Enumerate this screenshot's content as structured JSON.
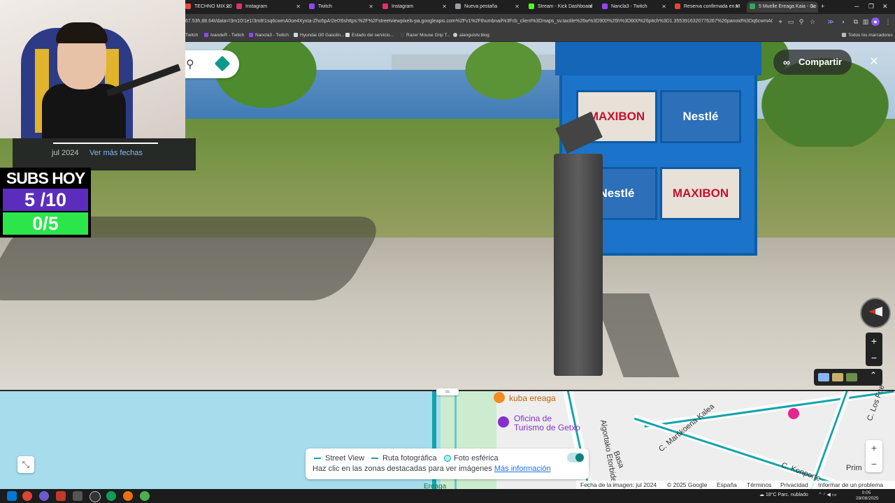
{
  "browser": {
    "tabs": [
      {
        "label": "TECHNO MIX 20",
        "color": "#e74c3c"
      },
      {
        "label": "Instagram",
        "color": "#e1306c"
      },
      {
        "label": "Twitch",
        "color": "#9146ff"
      },
      {
        "label": "Instagram",
        "color": "#e1306c"
      },
      {
        "label": "Nueva pestaña",
        "color": "#9aa0a6"
      },
      {
        "label": "Stream - Kick Dashboard",
        "color": "#53fc18"
      },
      {
        "label": "Nancla3 - Twitch",
        "color": "#9146ff"
      },
      {
        "label": "Reserva confirmada en M",
        "color": "#ea4335"
      },
      {
        "label": "5 Muelle Ereaga Kaia - Go",
        "color": "#34a853"
      }
    ],
    "new_tab": "+",
    "url": "67.53h,88.64t/data=!3m10!1e1!3m8!1sq6cwmA0oe4XyxIa-Zho5pA!2e0!6shttps:%2F%2Fstreetviewpixels-pa.googleapis.com%2Fv1%2Fthumbnail%3Fcb_client%3Dmaps_sv.tactile%26w%3D900%26h%3D600%26pitch%3D1.3553916320776267%26panoid%3Dq6cwmA0oe4...",
    "bookmarks": [
      "Twitch",
      "IvandeR - Twitch",
      "Nancla3 - Twitch",
      "Hyundai i30 Gasolin...",
      "Estado del servicio...",
      "Razer Mouse Grip T...",
      "alanguistv.blog"
    ],
    "all_bookmarks": "Todos los marcadores"
  },
  "streetview": {
    "share_label": "Compartir",
    "close_glyph": "✕",
    "kiosk_brands": [
      "MAXIBON",
      "Nestlé",
      "Nestlé",
      "MAXIBON"
    ]
  },
  "overlay": {
    "date": "jul 2024",
    "more_dates": "Ver más fechas",
    "subs_title": "SUBS HOY",
    "subs_count": "5 /10",
    "subs_goal": "0/5"
  },
  "map": {
    "place_1": "kuba ereaga",
    "place_2": "Oficina de\nTurismo de Getxo",
    "place_3": "Ereaga",
    "streets": [
      "Algortako Etorbidea",
      "C. Martikoena Kalea",
      "C. Konporte",
      "C. Los Fue",
      "Basa",
      "Prim"
    ],
    "legend": {
      "street_view": "Street View",
      "photo_route": "Ruta fotográfica",
      "sphere_photo": "Foto esférica",
      "hint": "Haz clic en las zonas destacadas para ver imágenes",
      "more_info": "Más información"
    },
    "footer": {
      "image_date": "Fecha de la imagen: jul 2024",
      "copyright": "© 2025 Google",
      "country": "España",
      "terms": "Términos",
      "privacy": "Privacidad",
      "report": "Informar de un problema"
    }
  },
  "taskbar": {
    "weather": "18°C  Parc. nublado",
    "time": "0:05",
    "date": "28/08/2025"
  },
  "colors": {
    "accent_teal": "#13a3ab",
    "subs_purple": "#5b2dbd",
    "subs_green": "#2ae64b"
  }
}
